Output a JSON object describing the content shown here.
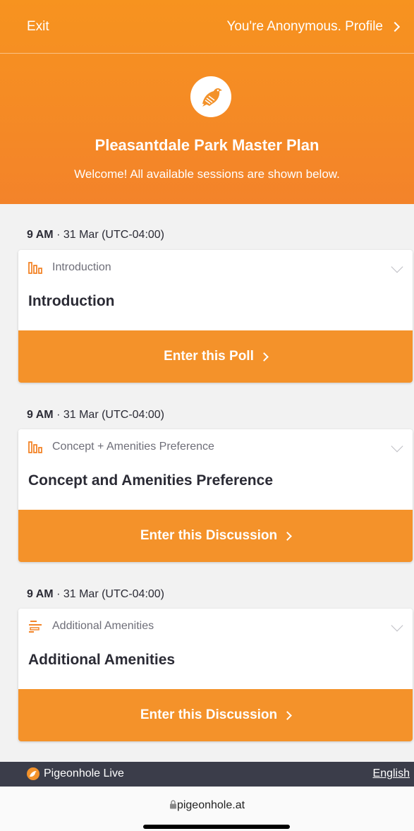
{
  "colors": {
    "accent": "#f4922a",
    "footer_bg": "#3b3d4a"
  },
  "topbar": {
    "exit_label": "Exit",
    "profile_label": "You're Anonymous. Profile"
  },
  "event": {
    "logo_icon": "pigeon-icon",
    "title": "Pleasantdale Park Master Plan",
    "welcome": "Welcome! All available sessions are shown below."
  },
  "sessions": [
    {
      "time_bold": "9 AM",
      "time_rest": " · 31 Mar (UTC-04:00)",
      "type_icon": "poll-bars-icon",
      "type_label": "Introduction",
      "name": "Introduction",
      "button_label": "Enter this Poll"
    },
    {
      "time_bold": "9 AM",
      "time_rest": " · 31 Mar (UTC-04:00)",
      "type_icon": "poll-bars-icon",
      "type_label": "Concept + Amenities Preference",
      "name": "Concept and Amenities Preference",
      "button_label": "Enter this Discussion"
    },
    {
      "time_bold": "9 AM",
      "time_rest": " · 31 Mar (UTC-04:00)",
      "type_icon": "discussion-icon",
      "type_label": "Additional Amenities",
      "name": "Additional Amenities",
      "button_label": "Enter this Discussion"
    }
  ],
  "footer": {
    "brand": "Pigeonhole Live",
    "language": "English"
  },
  "browser": {
    "url": "pigeonhole.at"
  }
}
